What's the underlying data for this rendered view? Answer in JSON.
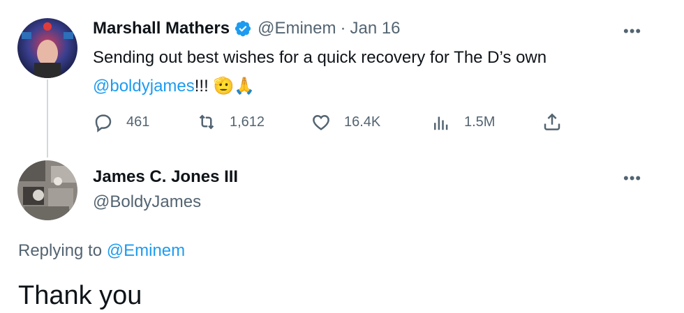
{
  "tweet": {
    "author_name": "Marshall Mathers",
    "author_handle": "@Eminem",
    "separator": "·",
    "date": "Jan 16",
    "text_line1": "Sending out best wishes for a quick recovery for The D’s own",
    "mention": "@boldyjames",
    "text_end": "!!!",
    "emojis": "🫡🙏",
    "more": "•••",
    "actions": {
      "replies": "461",
      "retweets": "1,612",
      "likes": "16.4K",
      "views": "1.5M"
    },
    "verified_color": "#1d9bf0"
  },
  "reply": {
    "author_name": "James C. Jones III",
    "author_handle": "@BoldyJames",
    "more": "•••",
    "replying_prefix": "Replying to",
    "replying_to": "@Eminem",
    "text": "Thank you"
  },
  "colors": {
    "accent": "#1d9bf0",
    "secondary_text": "#536471",
    "primary_text": "#0f1419"
  }
}
